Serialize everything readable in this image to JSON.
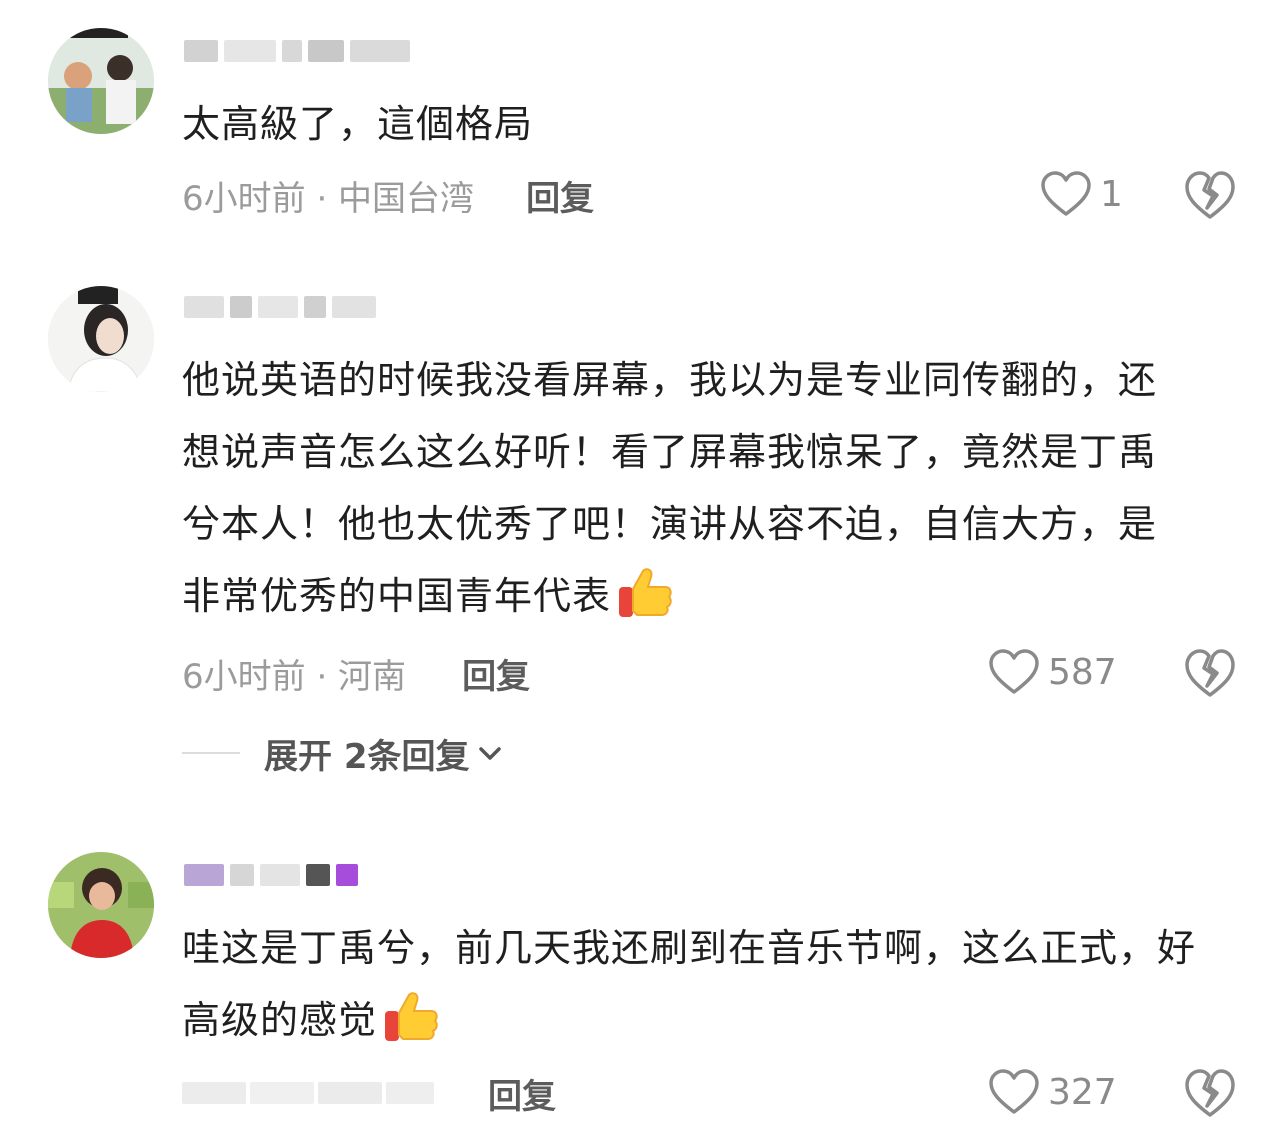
{
  "comments": [
    {
      "text": "太高級了，這個格局",
      "time": "6小时前 · 中国台湾",
      "reply_label": "回复",
      "likes": "1"
    },
    {
      "text": "他说英语的时候我没看屏幕，我以为是专业同传翻的，还想说声音怎么这么好听！看了屏幕我惊呆了，竟然是丁禹兮本人！他也太优秀了吧！演讲从容不迫，自信大方，是非常优秀的中国青年代表",
      "time": "6小时前 · 河南",
      "reply_label": "回复",
      "likes": "587",
      "expand_label": "展开 2条回复"
    },
    {
      "text": "哇这是丁禹兮，前几天我还刷到在音乐节啊，这么正式，好高级的感觉",
      "reply_label": "回复",
      "likes": "327"
    }
  ],
  "icons": {
    "like": "heart-outline-icon",
    "dislike": "broken-heart-icon",
    "emoji": "thumbs-up-emoji",
    "expand": "chevron-down-icon"
  },
  "colors": {
    "text": "#1f1f1f",
    "meta": "#9b9b9b",
    "reply": "#5c5c5c",
    "icon": "#8a8a8a"
  }
}
